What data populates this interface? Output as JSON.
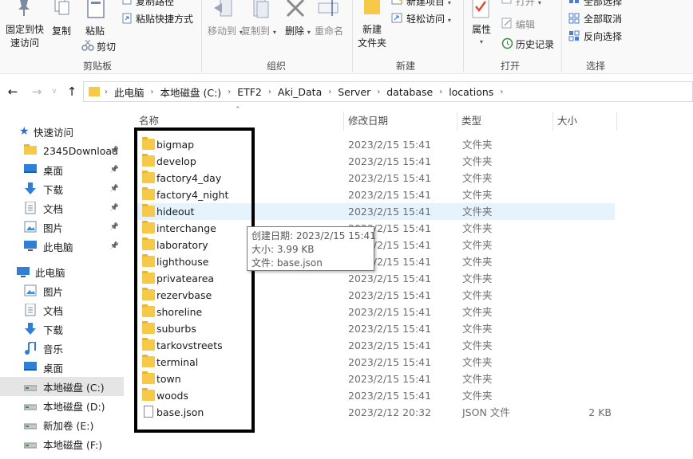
{
  "ribbon": {
    "clipboard": {
      "pin_label": "固定到快\n速访问",
      "pin_line1": "固定到快",
      "pin_line2": "速访问",
      "copy": "复制",
      "paste": "粘贴",
      "copy_path": "复制路径",
      "paste_shortcut": "粘贴快捷方式",
      "cut": "剪切",
      "group_label": "剪贴板"
    },
    "organize": {
      "move_to": "移动到",
      "copy_to": "复制到",
      "delete": "删除",
      "rename": "重命名",
      "group_label": "组织"
    },
    "new": {
      "new_folder_line1": "新建",
      "new_folder_line2": "文件夹",
      "new_item": "新建项目",
      "easy_access": "轻松访问",
      "group_label": "新建"
    },
    "open": {
      "properties": "属性",
      "open": "打开",
      "edit": "编辑",
      "history": "历史记录",
      "group_label": "打开"
    },
    "select": {
      "select_all": "全部选择",
      "select_none": "全部取消",
      "invert": "反向选择",
      "group_label": "选择"
    }
  },
  "nav": {
    "back_icon": "left-arrow-icon",
    "forward_icon": "right-arrow-icon",
    "recent_icon": "chevron-down-icon",
    "up_icon": "up-arrow-icon"
  },
  "breadcrumb": [
    "此电脑",
    "本地磁盘 (C:)",
    "ETF2",
    "Aki_Data",
    "Server",
    "database",
    "locations"
  ],
  "sidebar": {
    "quick_access": "快速访问",
    "quick_items": [
      {
        "label": "2345Download",
        "icon": "folder-icon",
        "pinned": true
      },
      {
        "label": "桌面",
        "icon": "desktop-icon",
        "pinned": true
      },
      {
        "label": "下载",
        "icon": "download-icon",
        "pinned": true
      },
      {
        "label": "文档",
        "icon": "document-icon",
        "pinned": true
      },
      {
        "label": "图片",
        "icon": "picture-icon",
        "pinned": true
      },
      {
        "label": "此电脑",
        "icon": "computer-icon",
        "pinned": true
      }
    ],
    "this_pc": "此电脑",
    "pc_items": [
      {
        "label": "图片",
        "icon": "picture-icon"
      },
      {
        "label": "文档",
        "icon": "document-icon"
      },
      {
        "label": "下载",
        "icon": "download-icon"
      },
      {
        "label": "音乐",
        "icon": "music-icon"
      },
      {
        "label": "桌面",
        "icon": "desktop-icon"
      },
      {
        "label": "本地磁盘 (C:)",
        "icon": "drive-icon",
        "selected": true
      },
      {
        "label": "本地磁盘 (D:)",
        "icon": "drive-icon"
      },
      {
        "label": "新加卷 (E:)",
        "icon": "drive-icon"
      },
      {
        "label": "本地磁盘 (F:)",
        "icon": "drive-icon"
      }
    ]
  },
  "columns": {
    "name": "名称",
    "date": "修改日期",
    "type": "类型",
    "size": "大小"
  },
  "files": [
    {
      "name": "bigmap",
      "date": "2023/2/15 15:41",
      "type": "文件夹",
      "size": "",
      "kind": "folder"
    },
    {
      "name": "develop",
      "date": "2023/2/15 15:41",
      "type": "文件夹",
      "size": "",
      "kind": "folder"
    },
    {
      "name": "factory4_day",
      "date": "2023/2/15 15:41",
      "type": "文件夹",
      "size": "",
      "kind": "folder"
    },
    {
      "name": "factory4_night",
      "date": "2023/2/15 15:41",
      "type": "文件夹",
      "size": "",
      "kind": "folder"
    },
    {
      "name": "hideout",
      "date": "2023/2/15 15:41",
      "type": "文件夹",
      "size": "",
      "kind": "folder"
    },
    {
      "name": "interchange",
      "date": "2023/2/15 15:41",
      "type": "文件夹",
      "size": "",
      "kind": "folder"
    },
    {
      "name": "laboratory",
      "date": "2023/2/15 15:41",
      "type": "文件夹",
      "size": "",
      "kind": "folder"
    },
    {
      "name": "lighthouse",
      "date": "2023/2/15 15:41",
      "type": "文件夹",
      "size": "",
      "kind": "folder"
    },
    {
      "name": "privatearea",
      "date": "2023/2/15 15:41",
      "type": "文件夹",
      "size": "",
      "kind": "folder"
    },
    {
      "name": "rezervbase",
      "date": "2023/2/15 15:41",
      "type": "文件夹",
      "size": "",
      "kind": "folder"
    },
    {
      "name": "shoreline",
      "date": "2023/2/15 15:41",
      "type": "文件夹",
      "size": "",
      "kind": "folder"
    },
    {
      "name": "suburbs",
      "date": "2023/2/15 15:41",
      "type": "文件夹",
      "size": "",
      "kind": "folder"
    },
    {
      "name": "tarkovstreets",
      "date": "2023/2/15 15:41",
      "type": "文件夹",
      "size": "",
      "kind": "folder"
    },
    {
      "name": "terminal",
      "date": "2023/2/15 15:41",
      "type": "文件夹",
      "size": "",
      "kind": "folder"
    },
    {
      "name": "town",
      "date": "2023/2/15 15:41",
      "type": "文件夹",
      "size": "",
      "kind": "folder"
    },
    {
      "name": "woods",
      "date": "2023/2/15 15:41",
      "type": "文件夹",
      "size": "",
      "kind": "folder"
    },
    {
      "name": "base.json",
      "date": "2023/2/12 20:32",
      "type": "JSON 文件",
      "size": "2 KB",
      "kind": "file"
    }
  ],
  "tooltip": {
    "created": "创建日期: 2023/2/15 15:41",
    "size": "大小: 3.99 KB",
    "file": "文件: base.json"
  },
  "colors": {
    "folder": "#f7c948",
    "hover_row": "#e5f3ff",
    "selected_nav": "#e5e5e5",
    "highlight_box": "#000000"
  }
}
